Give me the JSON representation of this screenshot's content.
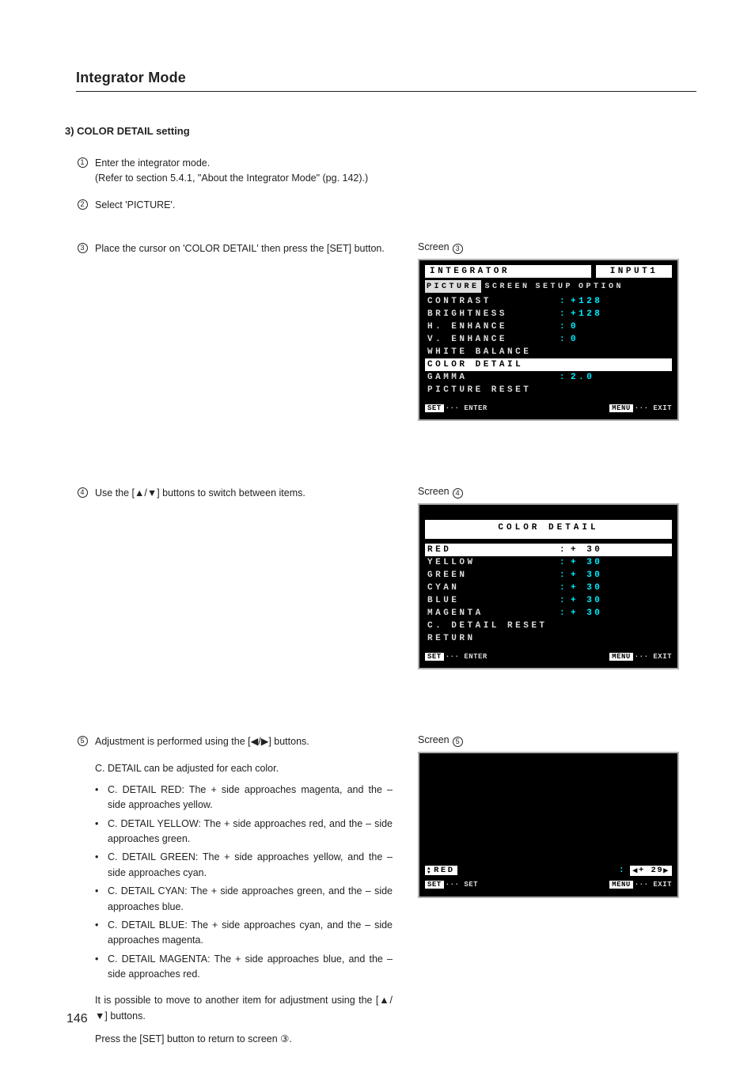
{
  "page": {
    "title": "Integrator Mode",
    "section_heading": "3) COLOR DETAIL setting",
    "page_number": "146"
  },
  "steps": {
    "s1": {
      "text": "Enter the integrator mode.",
      "note": "(Refer to section 5.4.1, \"About the Integrator Mode\" (pg. 142).)"
    },
    "s2": {
      "text": "Select 'PICTURE'."
    },
    "s3": {
      "text": "Place the cursor on 'COLOR DETAIL' then press the [SET] button."
    },
    "s4": {
      "text": "Use the [▲/▼] buttons to switch between items."
    },
    "s5": {
      "text": "Adjustment is performed using the [◀/▶] buttons.",
      "intro": "C. DETAIL can be adjusted for each color.",
      "bullets": [
        "C. DETAIL RED: The + side approaches magenta, and the – side approaches yellow.",
        "C. DETAIL YELLOW: The + side approaches red, and the – side approaches green.",
        "C. DETAIL GREEN: The + side approaches yellow, and the – side approaches cyan.",
        "C. DETAIL CYAN: The + side approaches green, and the – side approaches blue.",
        "C. DETAIL BLUE: The + side approaches cyan, and the – side approaches magenta.",
        "C. DETAIL MAGENTA: The + side approaches blue, and the – side approaches red."
      ],
      "para1": "It is possible to move to another item for adjustment using the [▲/▼] buttons.",
      "para2": "Press the [SET] button to return to screen ③."
    }
  },
  "screens": {
    "label_prefix": "Screen",
    "screen3": {
      "title_left": "INTEGRATOR",
      "title_right": "INPUT1",
      "tabs": [
        "PICTURE",
        "SCREEN",
        "SETUP",
        "OPTION"
      ],
      "items": [
        {
          "label": "CONTRAST",
          "value": "+128"
        },
        {
          "label": "BRIGHTNESS",
          "value": "+128"
        },
        {
          "label": "H. ENHANCE",
          "value": "   0"
        },
        {
          "label": "V. ENHANCE",
          "value": "   0"
        },
        {
          "label": "WHITE  BALANCE"
        },
        {
          "label": "COLOR  DETAIL",
          "selected": true
        },
        {
          "label": "GAMMA",
          "value": " 2.0"
        },
        {
          "label": "PICTURE RESET"
        }
      ],
      "footer_left": {
        "btn": "SET",
        "label": "ENTER"
      },
      "footer_right": {
        "btn": "MENU",
        "label": "EXIT"
      }
    },
    "screen4": {
      "title": "COLOR  DETAIL",
      "items": [
        {
          "label": "RED",
          "value": "+ 30",
          "selected": true
        },
        {
          "label": "YELLOW",
          "value": "+ 30"
        },
        {
          "label": "GREEN",
          "value": "+ 30"
        },
        {
          "label": "CYAN",
          "value": "+ 30"
        },
        {
          "label": "BLUE",
          "value": "+ 30"
        },
        {
          "label": "MAGENTA",
          "value": "+ 30"
        },
        {
          "label": "C. DETAIL  RESET"
        },
        {
          "label": " RETURN"
        }
      ],
      "footer_left": {
        "btn": "SET",
        "label": "ENTER"
      },
      "footer_right": {
        "btn": "MENU",
        "label": "EXIT"
      }
    },
    "screen5": {
      "item": "RED",
      "value": "+ 29",
      "footer_left": {
        "btn": "SET",
        "label": "SET"
      },
      "footer_right": {
        "btn": "MENU",
        "label": "EXIT"
      }
    }
  }
}
